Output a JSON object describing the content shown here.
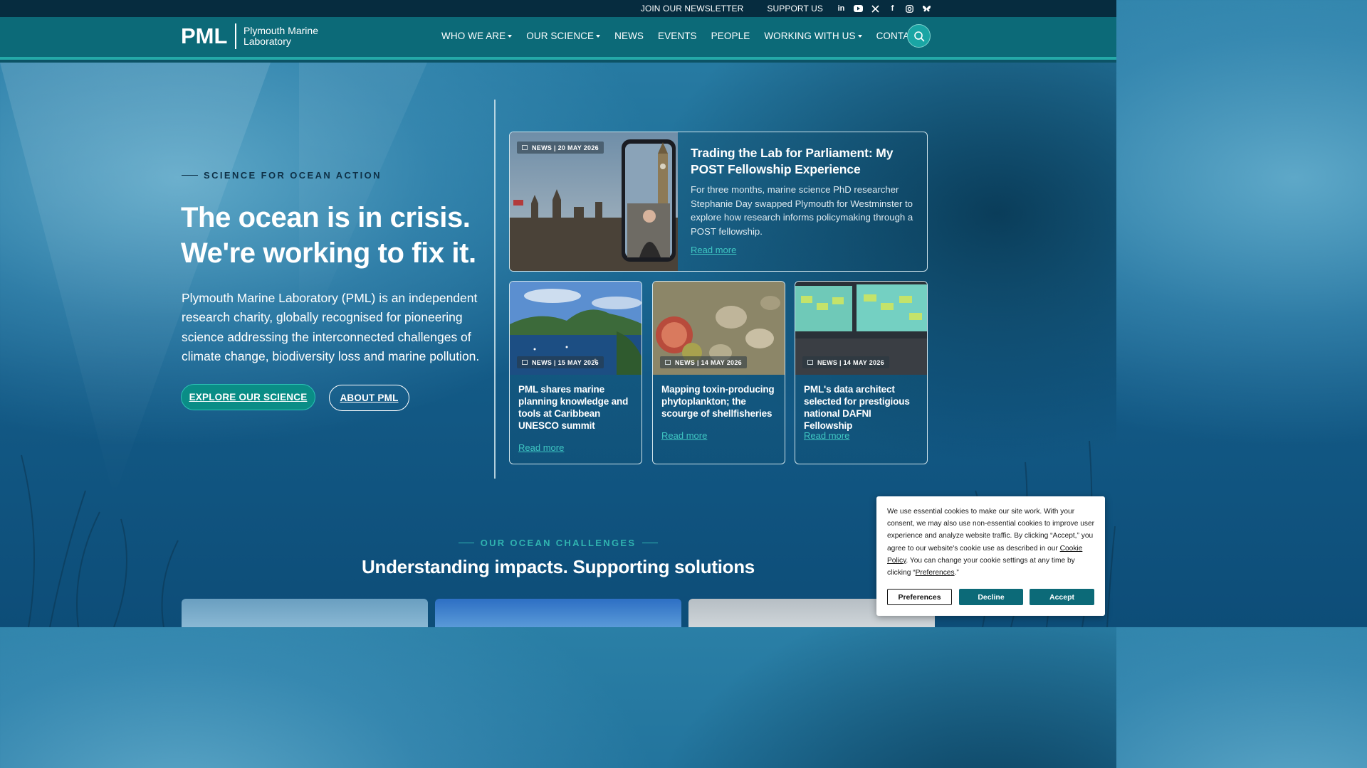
{
  "topbar": {
    "newsletter": "JOIN OUR NEWSLETTER",
    "support": "SUPPORT US",
    "social": [
      "linkedin-icon",
      "youtube-icon",
      "x-icon",
      "facebook-icon",
      "instagram-icon",
      "bluesky-icon"
    ]
  },
  "logo": {
    "mark": "PML",
    "line1": "Plymouth Marine",
    "line2": "Laboratory"
  },
  "nav": {
    "items": [
      {
        "label": "WHO WE ARE",
        "dropdown": true
      },
      {
        "label": "OUR SCIENCE",
        "dropdown": true
      },
      {
        "label": "NEWS",
        "dropdown": false
      },
      {
        "label": "EVENTS",
        "dropdown": false
      },
      {
        "label": "PEOPLE",
        "dropdown": false
      },
      {
        "label": "WORKING WITH US",
        "dropdown": true
      },
      {
        "label": "CONTACT",
        "dropdown": false
      }
    ],
    "search_icon": "search-icon"
  },
  "hero": {
    "eyebrow": "SCIENCE FOR OCEAN ACTION",
    "title_line1": "The ocean is in crisis.",
    "title_line2": "We're working to fix it.",
    "description": "Plymouth Marine Laboratory (PML) is an independent research charity, globally recognised for pioneering science addressing the interconnected challenges of climate change, biodiversity loss and marine pollution.",
    "primary_button": "EXPLORE OUR SCIENCE",
    "secondary_button": "ABOUT PML"
  },
  "featured": {
    "tag": "NEWS | 20 MAY 2026",
    "title": "Trading the Lab for Parliament: My POST Fellowship Experience",
    "text": "For three months, marine science PhD researcher Stephanie Day swapped Plymouth for Westminster to explore how research informs policymaking through a POST fellowship.",
    "read_more": "Read more"
  },
  "cards": [
    {
      "tag": "NEWS | 15 MAY 2026",
      "title": "PML shares marine planning knowledge and tools at Caribbean UNESCO summit",
      "read_more": "Read more"
    },
    {
      "tag": "NEWS | 14 MAY 2026",
      "title": "Mapping toxin-producing phytoplankton; the scourge of shellfisheries",
      "read_more": "Read more"
    },
    {
      "tag": "NEWS | 14 MAY 2026",
      "title": "PML's data architect selected for prestigious national DAFNI Fellowship",
      "read_more": "Read more"
    }
  ],
  "challenges": {
    "eyebrow": "OUR OCEAN CHALLENGES",
    "title": "Understanding impacts. Supporting solutions"
  },
  "cookie": {
    "text_1": "We use essential cookies to make our site work. With your consent, we may also use non-essential cookies to improve user experience and analyze website traffic. By clicking “Accept,” you agree to our website's cookie use as described in our ",
    "policy_link": "Cookie Policy",
    "text_2": ". You can change your cookie settings at any time by clicking “",
    "preferences_link": "Preferences",
    "text_3": ".”",
    "preferences_button": "Preferences",
    "decline_button": "Decline",
    "accept_button": "Accept"
  },
  "colors": {
    "topbar": "#062c3f",
    "navbar": "#0c6a78",
    "accent": "#24a9a8",
    "link": "#3fc6c2",
    "eyebrow_dark": "#0e3046"
  }
}
